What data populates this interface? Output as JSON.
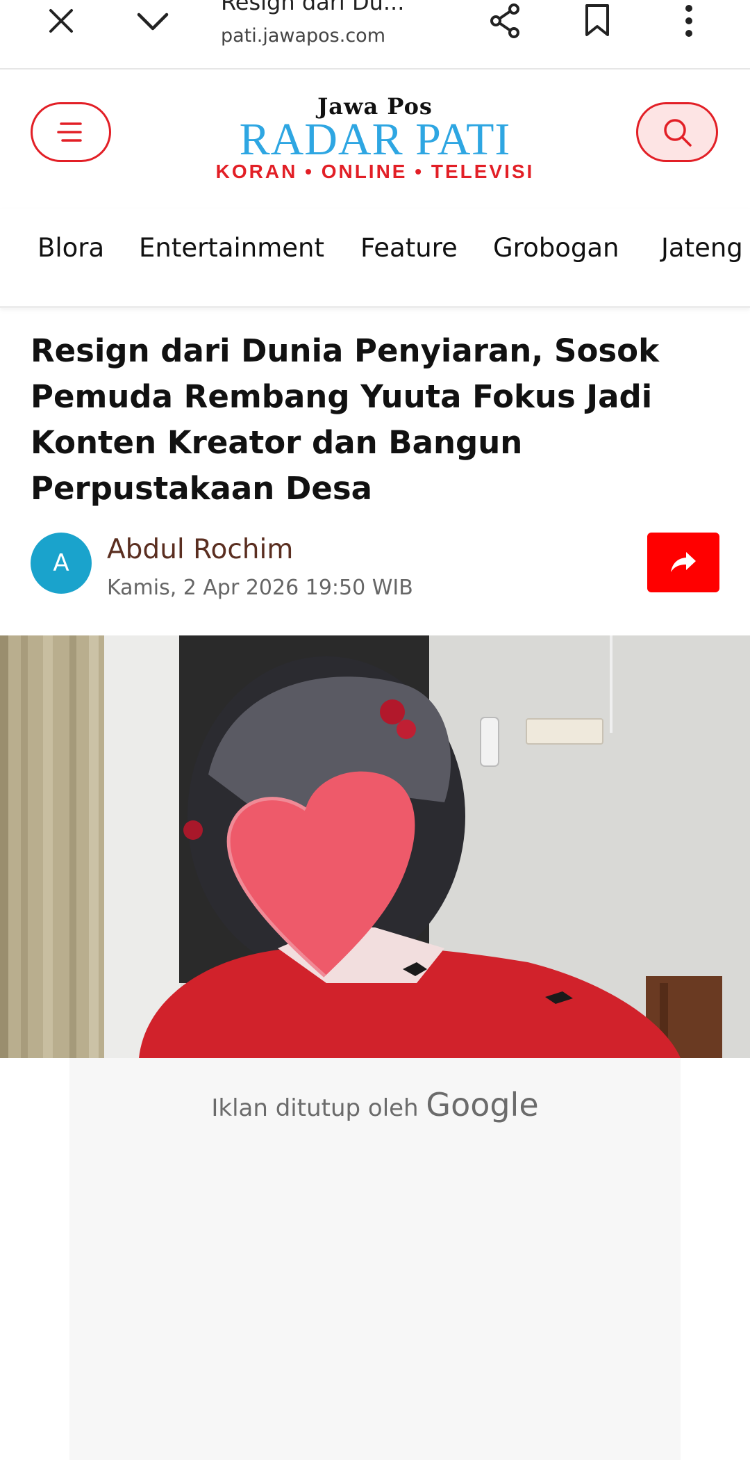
{
  "browser": {
    "title": "Resign dari Du...",
    "url": "pati.jawapos.com"
  },
  "header": {
    "logo_top": "Jawa Pos",
    "logo_main": "RADAR PATI",
    "logo_sub": "KORAN • ONLINE • TELEVISI"
  },
  "nav": {
    "items": [
      "Blora",
      "Entertainment",
      "Feature",
      "Grobogan",
      "Jateng"
    ]
  },
  "article": {
    "headline": "Resign dari Dunia Penyiaran, Sosok Pemuda Rembang Yuuta Fokus Jadi Konten Kreator dan Bangun Perpustakaan Desa",
    "avatar_letter": "A",
    "author": "Abdul Rochim",
    "date": "Kamis, 2 Apr 2026 19:50 WIB"
  },
  "ad": {
    "closed_text": "Iklan ditutup oleh",
    "brand": "Google"
  },
  "colors": {
    "brand_red": "#e21f26",
    "logo_blue": "#2ea6e2",
    "avatar_blue": "#1aa3cc",
    "share_red": "#ff0000"
  },
  "icons": {
    "close": "close-icon",
    "dropdown": "chevron-down-icon",
    "share": "share-icon",
    "bookmark": "bookmark-icon",
    "more": "more-vert-icon",
    "menu": "menu-icon",
    "search": "search-icon",
    "share_button": "share-arrow-icon"
  }
}
